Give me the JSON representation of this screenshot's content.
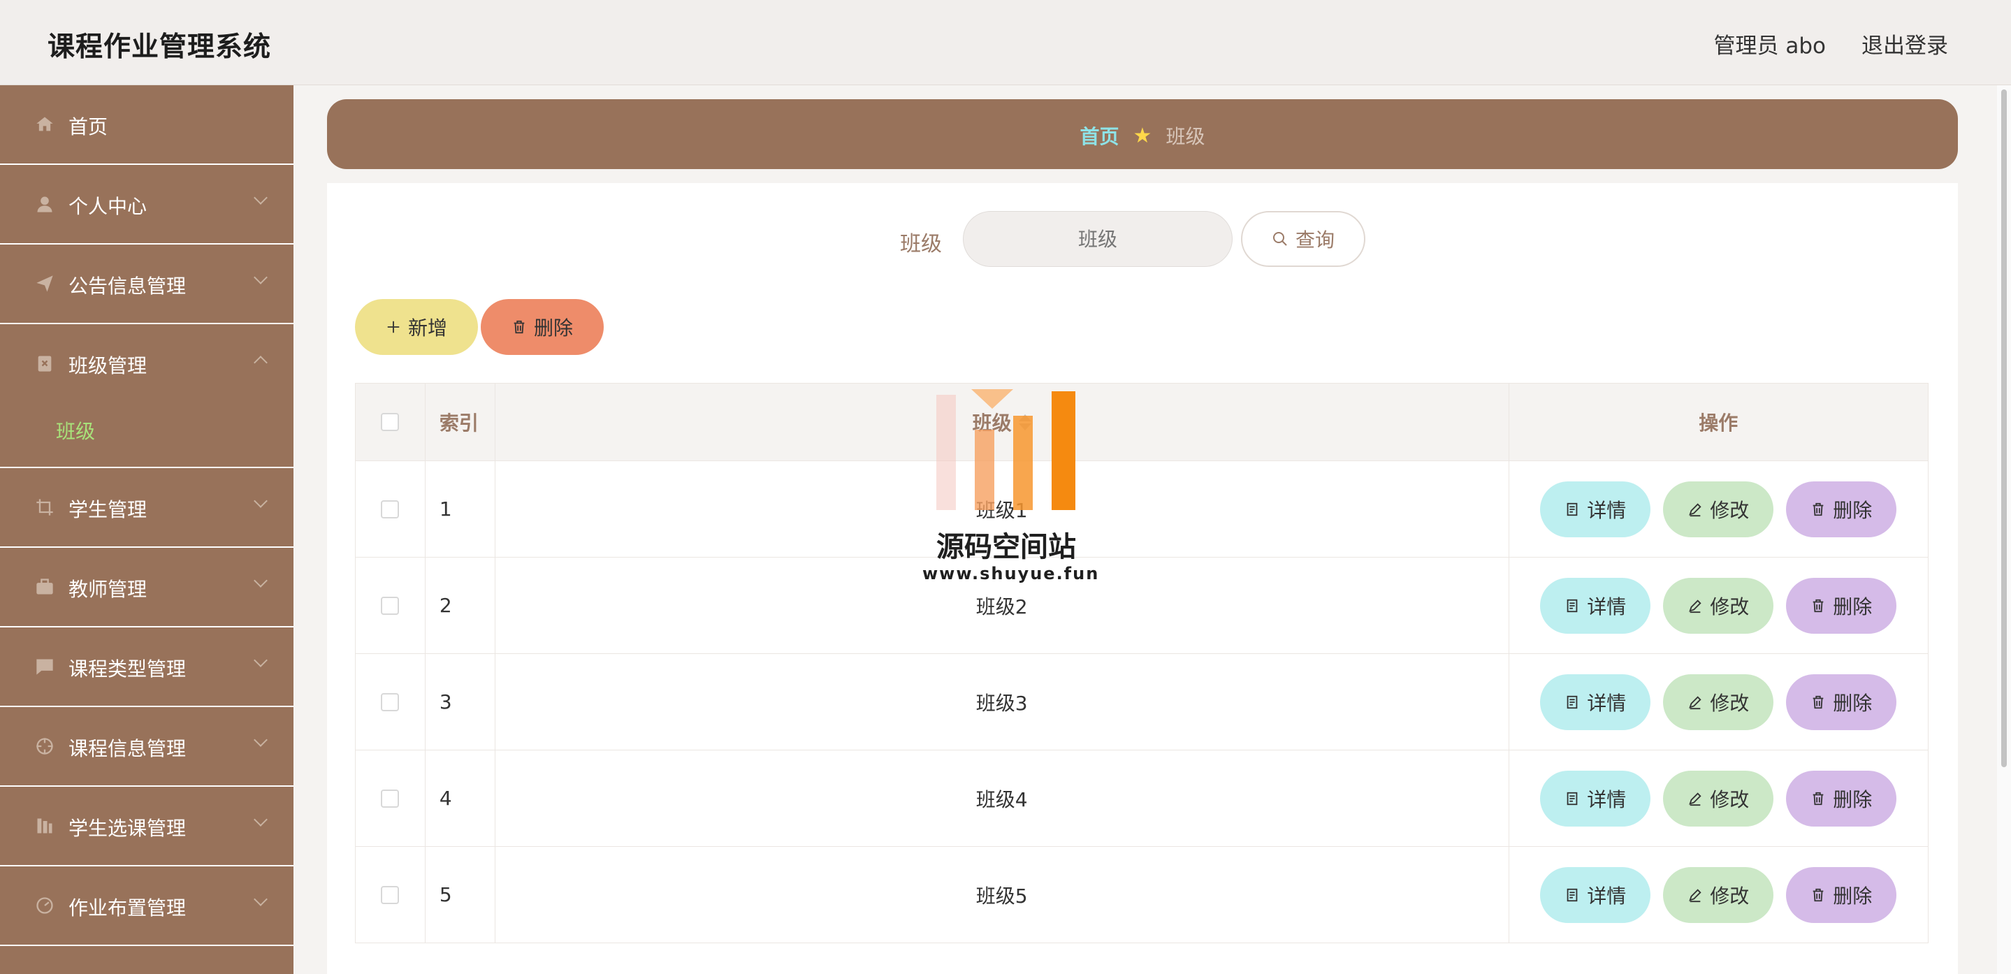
{
  "header": {
    "title": "课程作业管理系统",
    "user": "管理员 abo",
    "logout": "退出登录"
  },
  "sidebar": {
    "items": [
      {
        "label": "首页",
        "icon": "home-icon"
      },
      {
        "label": "个人中心",
        "icon": "user-icon"
      },
      {
        "label": "公告信息管理",
        "icon": "send-icon"
      },
      {
        "label": "班级管理",
        "icon": "clipboard-icon"
      },
      {
        "label": "学生管理",
        "icon": "crop-icon"
      },
      {
        "label": "教师管理",
        "icon": "briefcase-icon"
      },
      {
        "label": "课程类型管理",
        "icon": "chat-icon"
      },
      {
        "label": "课程信息管理",
        "icon": "target-icon"
      },
      {
        "label": "学生选课管理",
        "icon": "books-icon"
      },
      {
        "label": "作业布置管理",
        "icon": "dashboard-icon"
      }
    ],
    "submenu": {
      "label": "班级"
    }
  },
  "breadcrumb": {
    "home": "首页",
    "current": "班级"
  },
  "search": {
    "label": "班级",
    "placeholder": "班级",
    "button": "查询"
  },
  "actions": {
    "add": "新增",
    "delete": "删除"
  },
  "table": {
    "headers": {
      "index": "索引",
      "name": "班级",
      "ops": "操作"
    },
    "rows": [
      {
        "index": "1",
        "name": "班级1"
      },
      {
        "index": "2",
        "name": "班级2"
      },
      {
        "index": "3",
        "name": "班级3"
      },
      {
        "index": "4",
        "name": "班级4"
      },
      {
        "index": "5",
        "name": "班级5"
      }
    ],
    "ops": {
      "detail": "详情",
      "edit": "修改",
      "delete": "删除"
    }
  },
  "watermark": {
    "title": "源码空间站",
    "url": "www.shuyue.fun"
  },
  "colors": {
    "sidebar": "#98725a",
    "breadcrumb_home": "#8ee3e7",
    "submenu_active": "#a8e37a",
    "detail": "#bdeff0",
    "edit": "#cce8c7",
    "delete": "#d5bbe8",
    "add": "#efe28e",
    "del": "#ee8c6a"
  }
}
